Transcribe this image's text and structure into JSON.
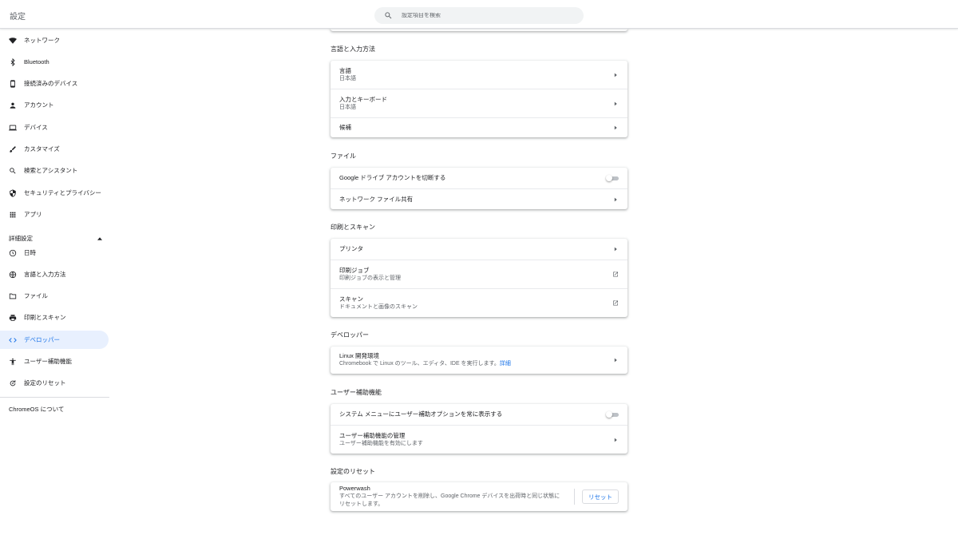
{
  "app": {
    "title": "設定"
  },
  "search": {
    "placeholder": "設定項目を検索"
  },
  "sidebar": {
    "items": [
      {
        "label": "ネットワーク",
        "icon": "wifi-icon"
      },
      {
        "label": "Bluetooth",
        "icon": "bluetooth-icon"
      },
      {
        "label": "接続済みのデバイス",
        "icon": "phone-icon"
      },
      {
        "label": "アカウント",
        "icon": "person-icon"
      },
      {
        "label": "デバイス",
        "icon": "laptop-icon"
      },
      {
        "label": "カスタマイズ",
        "icon": "brush-icon"
      },
      {
        "label": "検索とアシスタント",
        "icon": "search-icon"
      },
      {
        "label": "セキュリティとプライバシー",
        "icon": "shield-icon"
      },
      {
        "label": "アプリ",
        "icon": "apps-grid-icon"
      }
    ],
    "advanced_label": "詳細設定",
    "advanced_items": [
      {
        "label": "日時",
        "icon": "clock-icon"
      },
      {
        "label": "言語と入力方法",
        "icon": "globe-icon"
      },
      {
        "label": "ファイル",
        "icon": "folder-icon"
      },
      {
        "label": "印刷とスキャン",
        "icon": "printer-icon"
      },
      {
        "label": "デベロッパー",
        "icon": "code-icon",
        "active": true
      },
      {
        "label": "ユーザー補助機能",
        "icon": "accessibility-icon"
      },
      {
        "label": "設定のリセット",
        "icon": "reset-icon"
      }
    ],
    "about": "ChromeOS について"
  },
  "sections": {
    "language": {
      "title": "言語と入力方法",
      "rows": [
        {
          "label": "言語",
          "sub": "日本語"
        },
        {
          "label": "入力とキーボード",
          "sub": "日本語"
        },
        {
          "label": "候補"
        }
      ]
    },
    "files": {
      "title": "ファイル",
      "rows": [
        {
          "label": "Google ドライブ アカウントを切断する",
          "toggle": false
        },
        {
          "label": "ネットワーク ファイル共有"
        }
      ]
    },
    "print": {
      "title": "印刷とスキャン",
      "rows": [
        {
          "label": "プリンタ"
        },
        {
          "label": "印刷ジョブ",
          "sub": "印刷ジョブの表示と管理"
        },
        {
          "label": "スキャン",
          "sub": "ドキュメントと画像のスキャン"
        }
      ]
    },
    "developer": {
      "title": "デベロッパー",
      "rows": [
        {
          "label": "Linux 開発環境",
          "sub": "Chromebook で Linux のツール、エディタ、IDE を実行します。",
          "link": "詳細"
        }
      ]
    },
    "accessibility": {
      "title": "ユーザー補助機能",
      "rows": [
        {
          "label": "システム メニューにユーザー補助オプションを常に表示する",
          "toggle": false
        },
        {
          "label": "ユーザー補助機能の管理",
          "sub": "ユーザー補助機能を有効にします"
        }
      ]
    },
    "reset": {
      "title": "設定のリセット",
      "rows": [
        {
          "label": "Powerwash",
          "sub1": "すべてのユーザー アカウントを削除し、Google Chrome デバイスを出荷時と同じ状態に",
          "sub2": "リセットします。",
          "button": "リセット"
        }
      ]
    }
  },
  "colors": {
    "accent": "#1a73e8",
    "active_bg": "#e8f0fe"
  }
}
